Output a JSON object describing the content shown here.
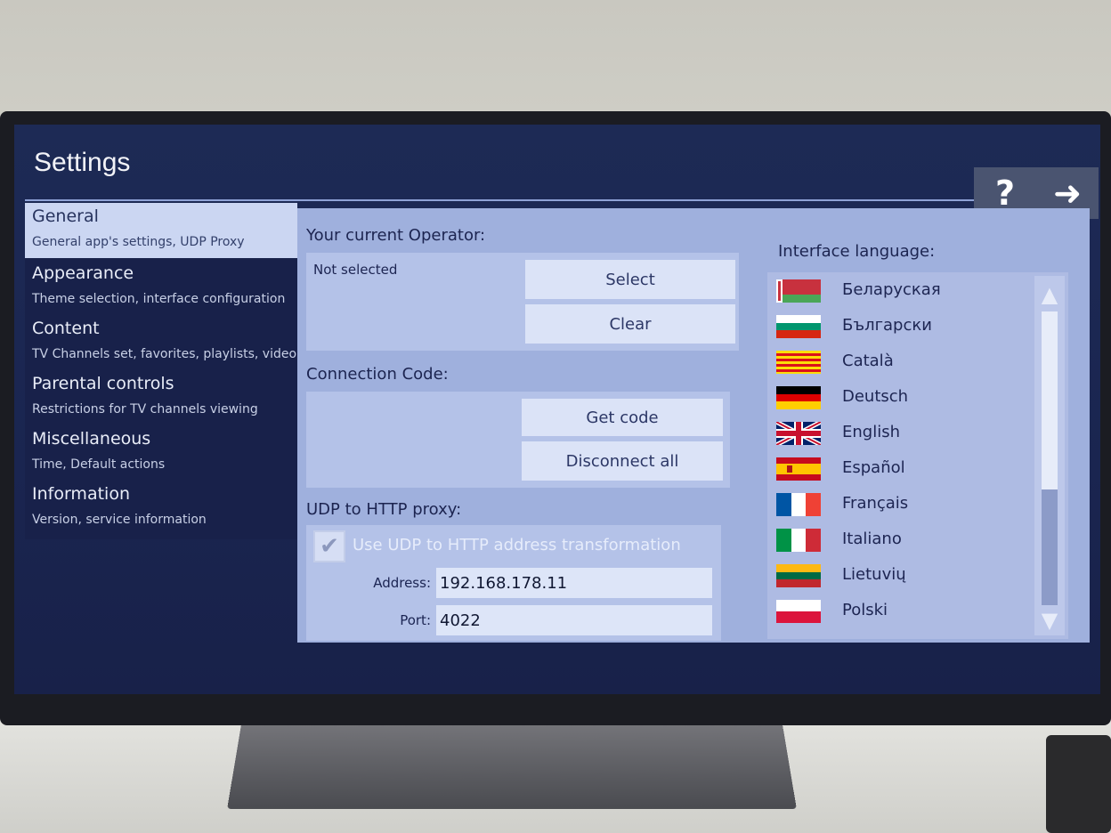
{
  "header": {
    "title": "Settings",
    "help_icon_label": "?",
    "exit_icon_label": "➜"
  },
  "sidebar": {
    "items": [
      {
        "label": "General",
        "sub": "General app's settings, UDP Proxy",
        "active": true
      },
      {
        "label": "Appearance",
        "sub": "Theme selection, interface configuration",
        "active": false
      },
      {
        "label": "Content",
        "sub": "TV Channels set, favorites, playlists, video",
        "active": false
      },
      {
        "label": "Parental controls",
        "sub": "Restrictions for TV channels viewing",
        "active": false
      },
      {
        "label": "Miscellaneous",
        "sub": "Time, Default actions",
        "active": false
      },
      {
        "label": "Information",
        "sub": "Version, service information",
        "active": false
      }
    ]
  },
  "operator": {
    "heading": "Your current Operator:",
    "status": "Not selected",
    "select_label": "Select",
    "clear_label": "Clear"
  },
  "connection": {
    "heading": "Connection Code:",
    "get_code_label": "Get code",
    "disconnect_label": "Disconnect all"
  },
  "udp_proxy": {
    "heading": "UDP to HTTP proxy:",
    "checkbox_label": "Use UDP to HTTP address transformation",
    "checkbox_checked": true,
    "address_label": "Address:",
    "address_value": "192.168.178.11",
    "port_label": "Port:",
    "port_value": "4022"
  },
  "language": {
    "heading": "Interface language:",
    "items": [
      {
        "name": "Беларуская",
        "flag_icon": "belarus-flag-icon"
      },
      {
        "name": "Български",
        "flag_icon": "bulgaria-flag-icon"
      },
      {
        "name": "Català",
        "flag_icon": "catalonia-flag-icon"
      },
      {
        "name": "Deutsch",
        "flag_icon": "germany-flag-icon"
      },
      {
        "name": "English",
        "flag_icon": "uk-flag-icon"
      },
      {
        "name": "Español",
        "flag_icon": "spain-flag-icon"
      },
      {
        "name": "Français",
        "flag_icon": "france-flag-icon"
      },
      {
        "name": "Italiano",
        "flag_icon": "italy-flag-icon"
      },
      {
        "name": "Lietuvių",
        "flag_icon": "lithuania-flag-icon"
      },
      {
        "name": "Polski",
        "flag_icon": "poland-flag-icon"
      }
    ],
    "scroll_up_icon": "triangle-up-icon",
    "scroll_down_icon": "triangle-down-icon"
  },
  "colors": {
    "screen_bg": "#1d2a55",
    "sidebar_active": "#cbd6f2",
    "content_bg": "#9fb0dd",
    "button_bg": "#dbe3f7"
  }
}
